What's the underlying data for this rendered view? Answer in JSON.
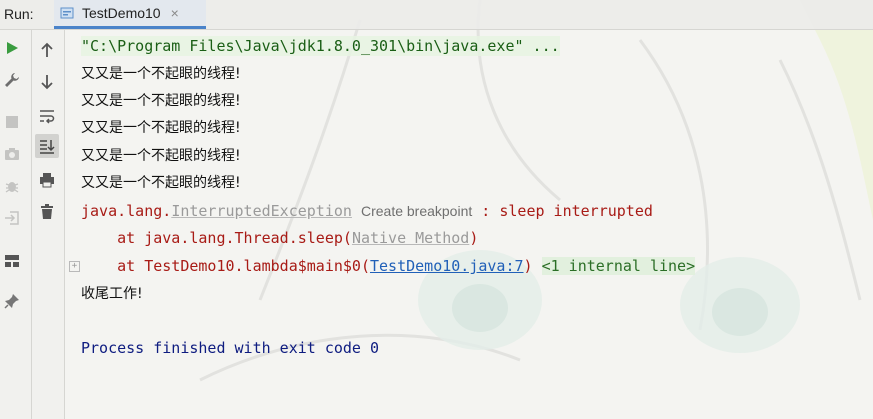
{
  "run_bar": {
    "label": "Run:",
    "tab_title": "TestDemo10",
    "tab_close": "×"
  },
  "left_toolbar": {
    "column1": [
      "run-icon",
      "wrench-icon",
      "stop-icon",
      "camera-icon",
      "bug-icon",
      "login-icon",
      "layout-icon",
      "pin-icon"
    ],
    "column2": [
      "up-arrow-icon",
      "down-arrow-icon",
      "soft-wrap-icon",
      "scroll-to-end-icon",
      "print-icon",
      "trash-icon"
    ]
  },
  "console": {
    "command": "\"C:\\Program Files\\Java\\jdk1.8.0_301\\bin\\java.exe\" ...",
    "output_lines": [
      "又又是一个不起眼的线程!",
      "又又是一个不起眼的线程!",
      "又又是一个不起眼的线程!",
      "又又是一个不起眼的线程!",
      "又又是一个不起眼的线程!"
    ],
    "exception": {
      "prefix": "java.lang.",
      "class": "InterruptedException",
      "hint": "Create breakpoint",
      "message": " : sleep interrupted"
    },
    "trace1": {
      "prefix": "    at java.lang.Thread.sleep(",
      "source": "Native Method",
      "suffix": ")"
    },
    "trace2": {
      "prefix": "    at TestDemo10.lambda$main$0(",
      "source": "TestDemo10.java:7",
      "suffix": ")",
      "folded": "<1 internal line>"
    },
    "final_output": "收尾工作!",
    "exit": "Process finished with exit code 0"
  },
  "colors": {
    "accent": "#4a83c9",
    "command": "#1a5e15",
    "error": "#a81b16",
    "link": "#2160b8",
    "process": "#0e1c80"
  }
}
